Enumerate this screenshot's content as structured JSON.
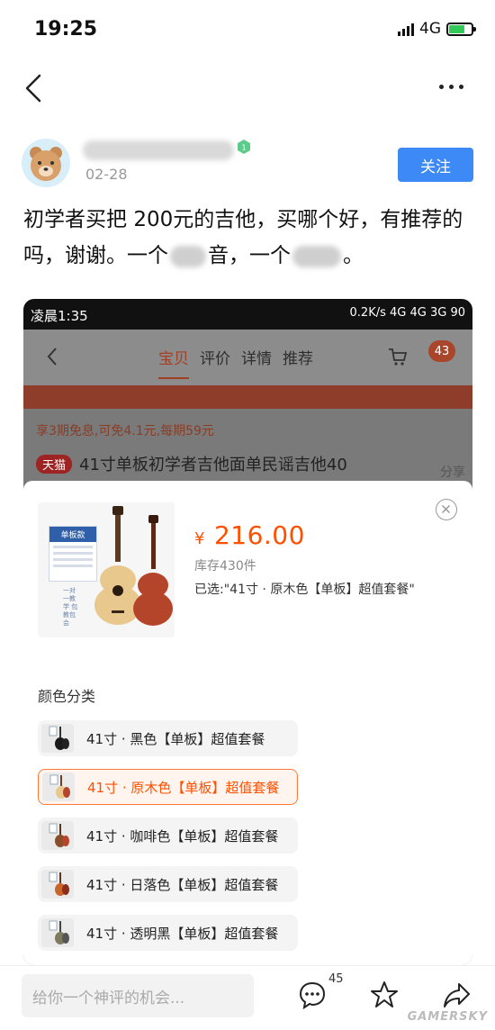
{
  "status_bar": {
    "time": "19:25",
    "network": "4G"
  },
  "post": {
    "date": "02-28",
    "follow_label": "关注",
    "text_part1": "初学者买把",
    "text_price": "200",
    "text_part2": "元的吉他，买哪个好，有推荐的吗，谢谢。一个",
    "text_part3": "音，一个",
    "text_part4": "。"
  },
  "embedded": {
    "status": {
      "time": "凌晨1:35",
      "info": "0.2K/s 4G 4G 3G 90"
    },
    "tabs": [
      "宝贝",
      "评价",
      "详情",
      "推荐"
    ],
    "cart_count": "43",
    "promo": "享3期免息,可免4.1元,每期59元",
    "tmall_tag": "天猫",
    "title": "41寸单板初学者吉他面单民谣吉他40",
    "share_label": "分享",
    "sku": {
      "currency": "¥",
      "price": "216.00",
      "stock": "库存430件",
      "selected": "已选:\"41寸 · 原木色【单板】超值套餐\"",
      "color_label": "颜色分类",
      "options": [
        "41寸 · 黑色【单板】超值套餐",
        "41寸 · 原木色【单板】超值套餐",
        "41寸 · 咖啡色【单板】超值套餐",
        "41寸 · 日落色【单板】超值套餐",
        "41寸 · 透明黑【单板】超值套餐"
      ],
      "selected_index": 1,
      "product_card_title": "单板款",
      "product_card_side": "一对一教学 包教包会"
    }
  },
  "bottom": {
    "comment_placeholder": "给你一个神评的机会...",
    "comment_count": "45"
  },
  "watermark": "GAMERSKY",
  "colors": {
    "accent": "#3d8af7",
    "price": "#ff5000",
    "selected_border": "#ff7a3a"
  }
}
